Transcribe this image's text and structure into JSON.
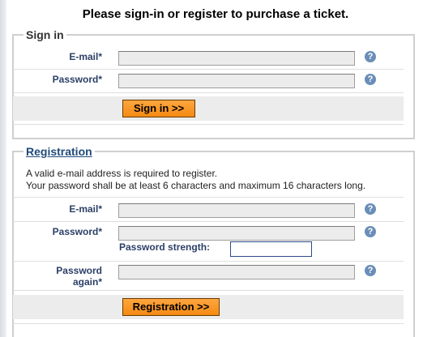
{
  "headline": "Please sign-in or register to purchase a ticket.",
  "signin": {
    "legend": "Sign in",
    "email_label": "E-mail*",
    "password_label": "Password*",
    "button_label": "Sign in >>",
    "help_icon": "question-mark-icon"
  },
  "registration": {
    "legend": "Registration",
    "info_line1": "A valid e-mail address is required to register.",
    "info_line2": "Your password shall be at least 6 characters and maximum 16 characters long.",
    "email_label": "E-mail*",
    "password_label": "Password*",
    "strength_label": "Password strength:",
    "password_again_label_line1": "Password",
    "password_again_label_line2": "again*",
    "button_label": "Registration >>",
    "help_icon": "question-mark-icon"
  },
  "colors": {
    "button_orange": "#f48a12",
    "label_blue": "#2b3f66",
    "help_icon_blue": "#6a8eb8"
  }
}
